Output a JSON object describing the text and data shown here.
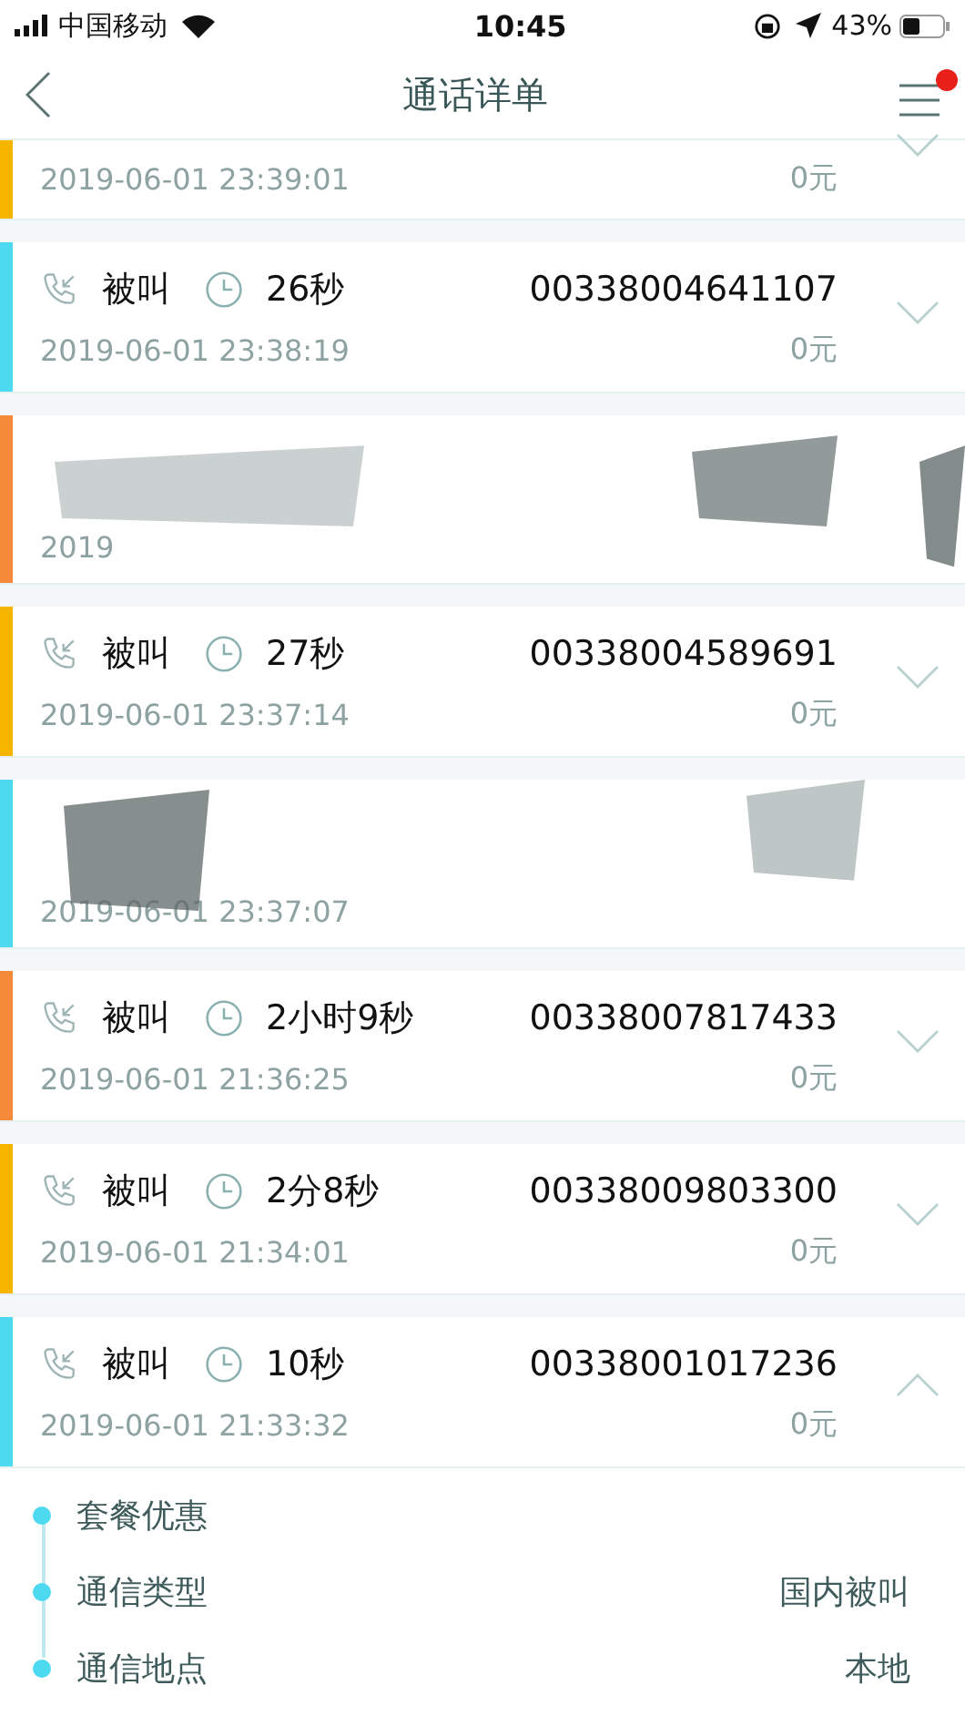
{
  "status_bar": {
    "carrier": "中国移动",
    "time": "10:45",
    "battery": "43%"
  },
  "nav": {
    "title": "通话详单",
    "menu_badge": true
  },
  "records": [
    {
      "kind": "cut",
      "color": "#f7b500",
      "datetime": "2019-06-01 23:39:01",
      "fee": "0元",
      "expanded": false
    },
    {
      "kind": "call",
      "color": "#4dd9f0",
      "direction": "被叫",
      "duration": "26秒",
      "number": "00338004641107",
      "datetime": "2019-06-01 23:38:19",
      "fee": "0元",
      "expanded": false
    },
    {
      "kind": "redacted",
      "color": "#f58a3a",
      "datetime": "2019"
    },
    {
      "kind": "call",
      "color": "#f7b500",
      "direction": "被叫",
      "duration": "27秒",
      "number": "00338004589691",
      "datetime": "2019-06-01 23:37:14",
      "fee": "0元",
      "expanded": false
    },
    {
      "kind": "redacted",
      "color": "#4dd9f0",
      "datetime": "2019-06-01 23:37:07"
    },
    {
      "kind": "call",
      "color": "#f58a3a",
      "direction": "被叫",
      "duration": "2小时9秒",
      "number": "00338007817433",
      "datetime": "2019-06-01 21:36:25",
      "fee": "0元",
      "expanded": false
    },
    {
      "kind": "call",
      "color": "#f7b500",
      "direction": "被叫",
      "duration": "2分8秒",
      "number": "00338009803300",
      "datetime": "2019-06-01 21:34:01",
      "fee": "0元",
      "expanded": false
    },
    {
      "kind": "call",
      "color": "#4dd9f0",
      "direction": "被叫",
      "duration": "10秒",
      "number": "00338001017236",
      "datetime": "2019-06-01 21:33:32",
      "fee": "0元",
      "expanded": true,
      "details": [
        {
          "label": "套餐优惠"
        },
        {
          "label": "通信类型",
          "value": "国内被叫"
        },
        {
          "label": "通信地点",
          "value": "本地"
        }
      ]
    }
  ]
}
